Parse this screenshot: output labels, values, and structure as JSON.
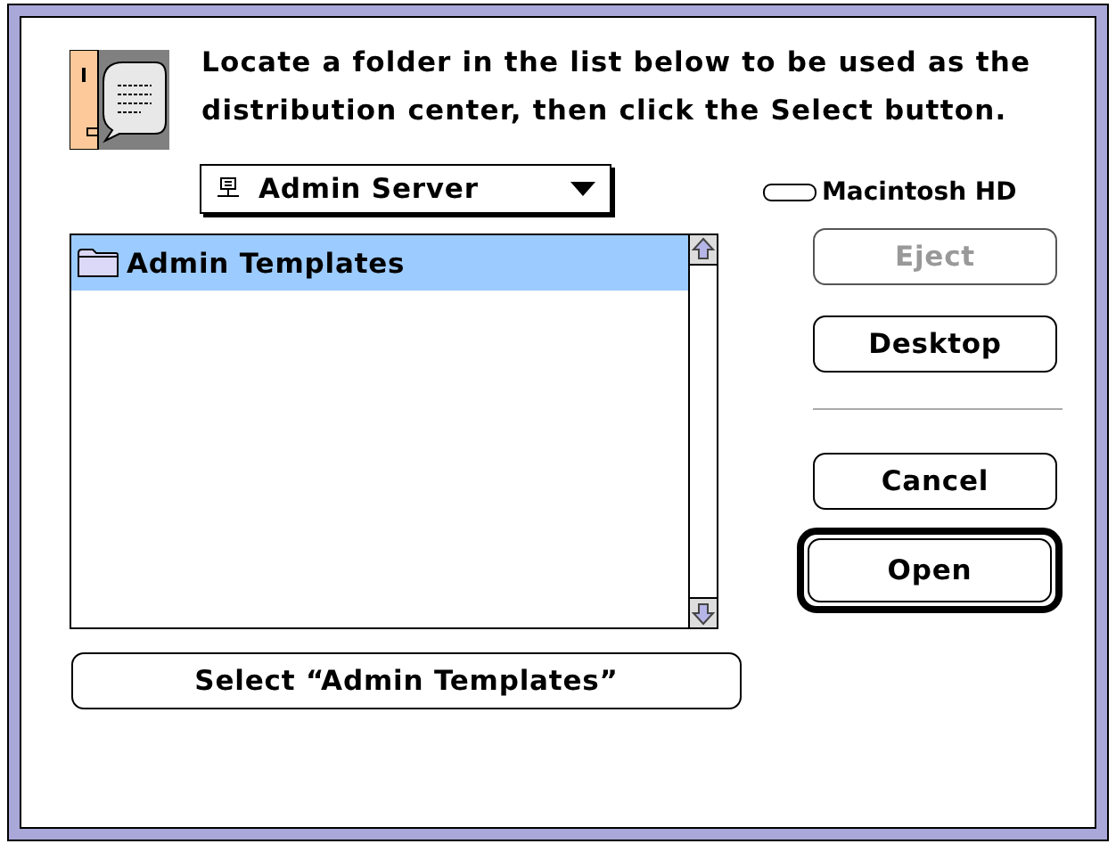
{
  "message": "Locate a folder in the list below to be used as the distribution center, then click the Select button.",
  "location_popup": {
    "label": "Admin Server"
  },
  "volume": {
    "name": "Macintosh HD"
  },
  "file_list": [
    {
      "name": "Admin Templates",
      "selected": true
    }
  ],
  "volume_buttons": [
    {
      "label": "Eject",
      "disabled": true,
      "default": false
    },
    {
      "label": "Desktop",
      "disabled": false,
      "default": false
    }
  ],
  "action_buttons": [
    {
      "label": "Cancel",
      "disabled": false,
      "default": false
    },
    {
      "label": "Open",
      "disabled": false,
      "default": true
    }
  ],
  "select_button": {
    "label": "Select “Admin Templates”"
  }
}
